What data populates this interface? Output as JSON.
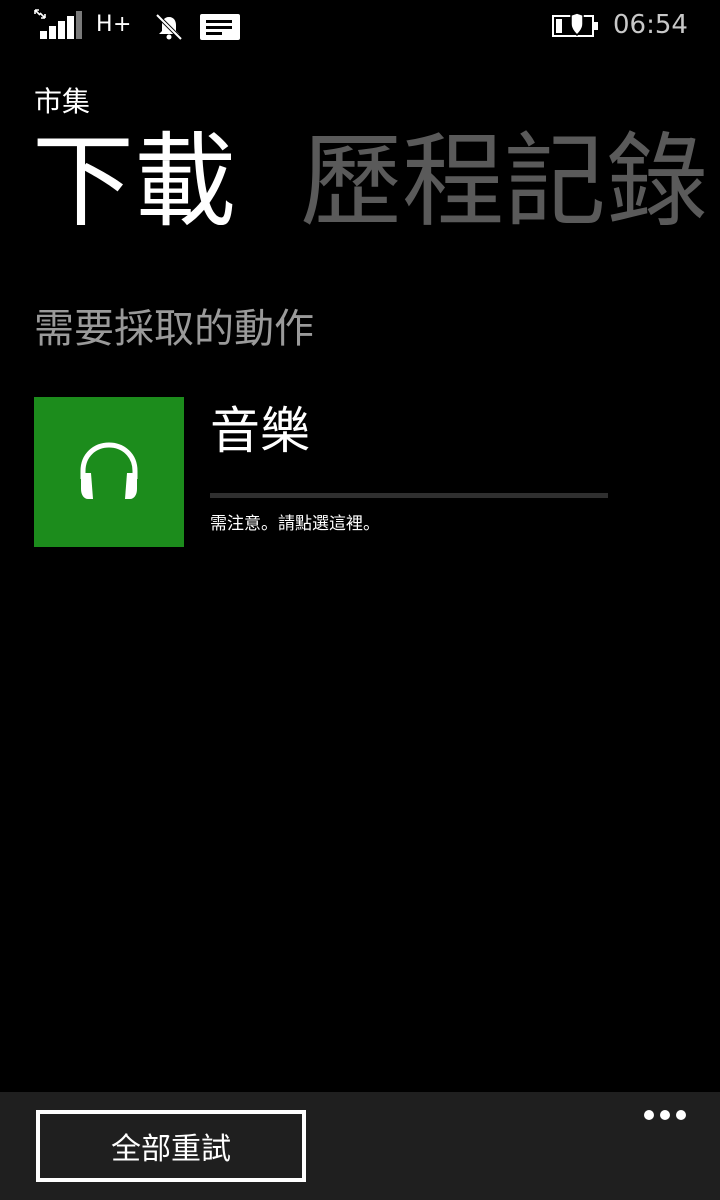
{
  "status_bar": {
    "network_type": "H+",
    "time": "06:54",
    "icons": [
      "signal-strength-icon",
      "notification-muted-icon",
      "message-icon",
      "battery-saver-icon"
    ]
  },
  "header": {
    "app_title": "市集",
    "tabs": [
      {
        "label": "下載",
        "active": true
      },
      {
        "label": "歷程記錄",
        "active": false
      }
    ]
  },
  "section": {
    "heading": "需要採取的動作"
  },
  "download_item": {
    "name": "音樂",
    "status": "需注意。請點選這裡。",
    "icon": "headphones-icon",
    "progress": 0,
    "tile_color": "#1c8c1c"
  },
  "app_bar": {
    "retry_label": "全部重試",
    "more_icon": "ellipsis-icon"
  },
  "colors": {
    "background": "#000000",
    "accent": "#1c8c1c",
    "inactive_tab": "#5a5a5a",
    "app_bar": "#1f1f1f"
  }
}
